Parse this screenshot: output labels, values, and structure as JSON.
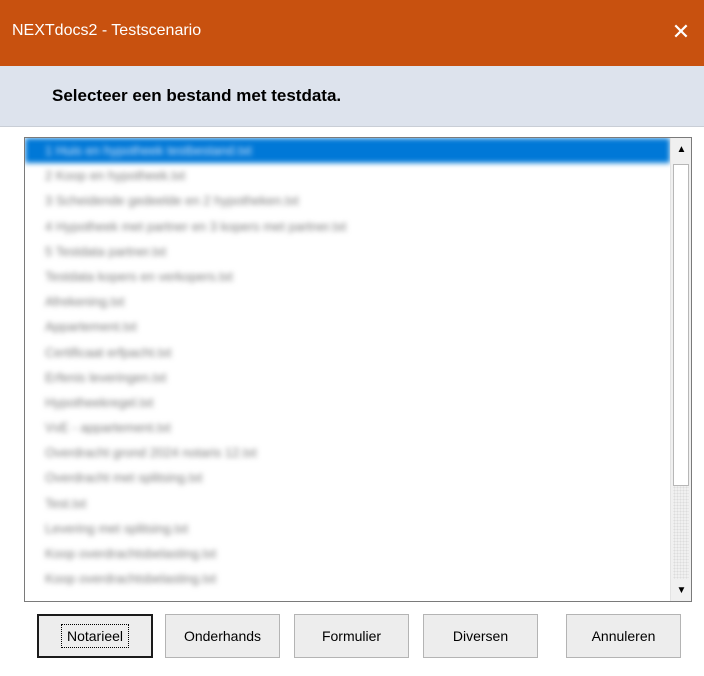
{
  "window": {
    "title": "NEXTdocs2 - Testscenario",
    "close_glyph": "✕",
    "accent": "#c8510f"
  },
  "header": {
    "prompt": "Selecteer een bestand met testdata."
  },
  "list": {
    "items": [
      "1 Huis en hypotheek testbestand.txt",
      "2 Koop en hypotheek.txt",
      "3 Scheidende gedeelde en 2 hypotheken.txt",
      "4 Hypotheek met partner en 3 kopers met partner.txt",
      "5 Testdata partner.txt",
      "Testdata kopers en verkopers.txt",
      "Afrekening.txt",
      "Appartement.txt",
      "Certificaat erfpacht.txt",
      "Erfenis leveringen.txt",
      "Hypotheekregel.txt",
      "VvE - appartement.txt",
      "Overdracht grond 2024 notaris 12.txt",
      "Overdracht met splitsing.txt",
      "Test.txt",
      "Levering met splitsing.txt",
      "Koop overdrachtsbelasting.txt",
      "Koop overdrachtsbelasting.txt"
    ],
    "selected_index": 0,
    "scroll_up_glyph": "▲",
    "scroll_down_glyph": "▼"
  },
  "buttons": {
    "notarieel": "Notarieel",
    "onderhands": "Onderhands",
    "formulier": "Formulier",
    "diversen": "Diversen",
    "annuleren": "Annuleren"
  }
}
